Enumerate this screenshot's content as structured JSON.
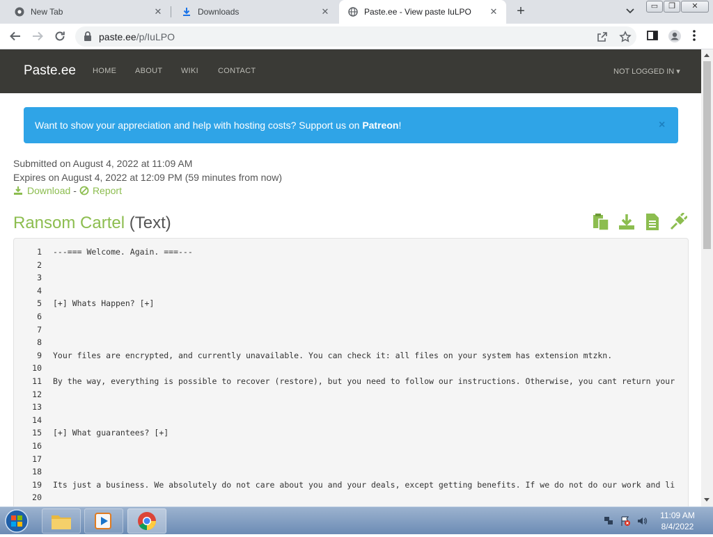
{
  "tabs": [
    {
      "title": "New Tab",
      "icon": "chrome-icon"
    },
    {
      "title": "Downloads",
      "icon": "download-icon"
    },
    {
      "title": "Paste.ee - View paste IuLPO",
      "icon": "globe-icon"
    }
  ],
  "window_controls": {
    "minimize": "▭",
    "restore": "❐",
    "close": "✕"
  },
  "address": {
    "domain": "paste.ee",
    "path": "/p/IuLPO"
  },
  "site": {
    "brand": "Paste.ee",
    "nav": [
      "HOME",
      "ABOUT",
      "WIKI",
      "CONTACT"
    ],
    "account": "NOT LOGGED IN"
  },
  "alert": {
    "text": "Want to show your appreciation and help with hosting costs? Support us on ",
    "link": "Patreon",
    "suffix": "!",
    "close": "×"
  },
  "meta": {
    "submitted": "Submitted on August 4, 2022 at 11:09 AM",
    "expires": "Expires on August 4, 2022 at 12:09 PM (59 minutes from now)",
    "download": "Download",
    "separator": "-",
    "report": "Report"
  },
  "paste": {
    "name": "Ransom Cartel",
    "type": "(Text)"
  },
  "code_lines": [
    {
      "n": "1",
      "t": "---=== Welcome. Again. ===---"
    },
    {
      "n": "2",
      "t": ""
    },
    {
      "n": "3",
      "t": ""
    },
    {
      "n": "4",
      "t": ""
    },
    {
      "n": "5",
      "t": "[+] Whats Happen? [+]"
    },
    {
      "n": "6",
      "t": ""
    },
    {
      "n": "7",
      "t": ""
    },
    {
      "n": "8",
      "t": ""
    },
    {
      "n": "9",
      "t": "Your files are encrypted, and currently unavailable. You can check it: all files on your system has extension mtzkn."
    },
    {
      "n": "10",
      "t": ""
    },
    {
      "n": "11",
      "t": "By the way, everything is possible to recover (restore), but you need to follow our instructions. Otherwise, you cant return your"
    },
    {
      "n": "12",
      "t": ""
    },
    {
      "n": "13",
      "t": ""
    },
    {
      "n": "14",
      "t": ""
    },
    {
      "n": "15",
      "t": "[+] What guarantees? [+]"
    },
    {
      "n": "16",
      "t": ""
    },
    {
      "n": "17",
      "t": ""
    },
    {
      "n": "18",
      "t": ""
    },
    {
      "n": "19",
      "t": "Its just a business. We absolutely do not care about you and your deals, except getting benefits. If we do not do our work and li"
    },
    {
      "n": "20",
      "t": ""
    }
  ],
  "clock": {
    "time": "11:09 AM",
    "date": "8/4/2022"
  },
  "colors": {
    "accent_green": "#8cbd4f",
    "alert_blue": "#2fa4e7",
    "navbar": "#3a3a36"
  }
}
